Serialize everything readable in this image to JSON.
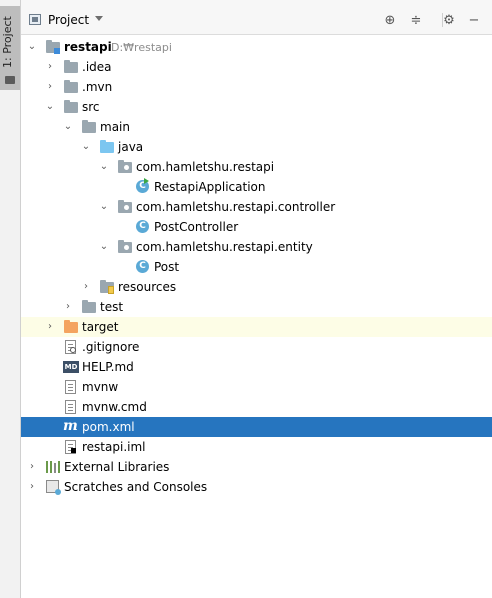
{
  "sidebar": {
    "tab_label": "1: Project"
  },
  "header": {
    "title": "Project",
    "actions": [
      "locate-icon",
      "collapse-all-icon",
      "settings-icon",
      "hide-icon"
    ]
  },
  "tree": {
    "root": {
      "label": "restapi",
      "path": "D:₩restapi"
    },
    "idea": ".idea",
    "mvn": ".mvn",
    "src": "src",
    "main": "main",
    "java": "java",
    "pkg1": "com.hamletshu.restapi",
    "cls1": "RestapiApplication",
    "pkg2": "com.hamletshu.restapi.controller",
    "cls2": "PostController",
    "pkg3": "com.hamletshu.restapi.entity",
    "cls3": "Post",
    "resources": "resources",
    "test": "test",
    "target": "target",
    "gitignore": ".gitignore",
    "help": "HELP.md",
    "mvnw": "mvnw",
    "mvnwcmd": "mvnw.cmd",
    "pom": "pom.xml",
    "iml": "restapi.iml",
    "extlib": "External Libraries",
    "scratches": "Scratches and Consoles"
  },
  "colors": {
    "selection": "#2675bf",
    "excluded_row": "#fdfde6",
    "source_folder": "#7cc6f0",
    "excluded_folder": "#f4a460"
  }
}
